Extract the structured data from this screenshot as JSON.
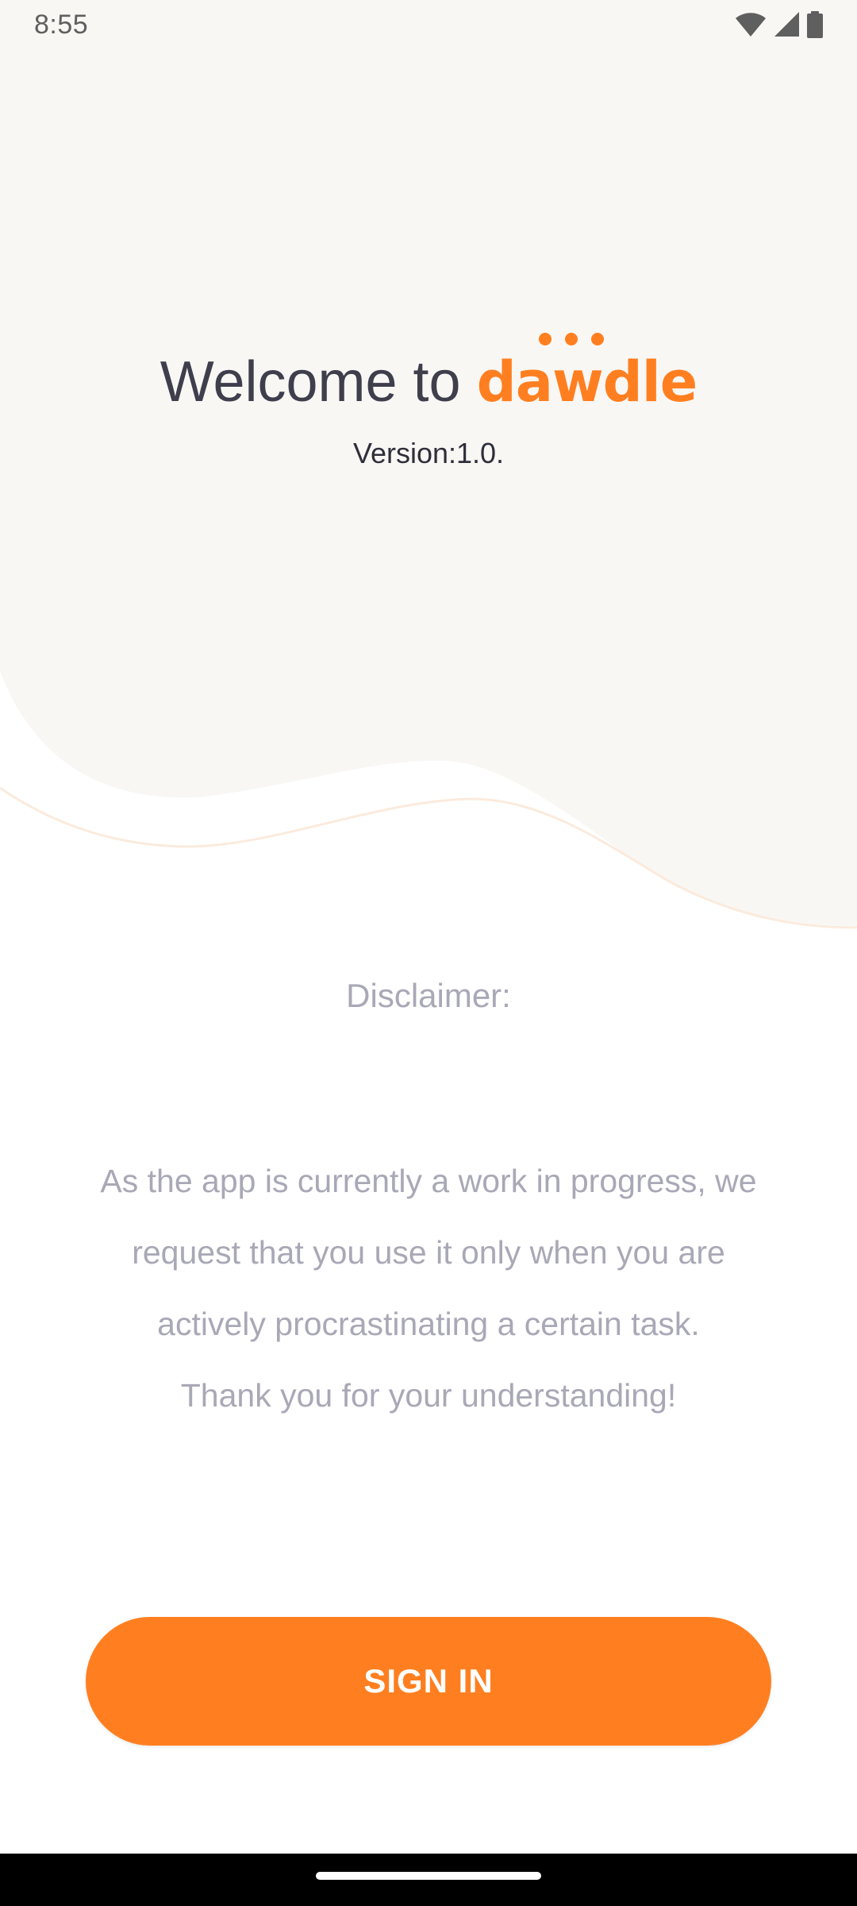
{
  "status_bar": {
    "time": "8:55",
    "icons": [
      "wifi-icon",
      "signal-icon",
      "battery-icon"
    ]
  },
  "header": {
    "welcome_prefix": "Welcome to",
    "brand_name": "dawdle",
    "version": "Version:1.0."
  },
  "disclaimer": {
    "title": "Disclaimer:",
    "lines": [
      "As the app is currently a work in progress, we",
      "request that you use it only when you are",
      "actively procrastinating a certain task.",
      "Thank you for your understanding!"
    ]
  },
  "actions": {
    "sign_in_label": "SIGN IN"
  },
  "colors": {
    "accent": "#FF7F20",
    "background_top": "#F9F7F4",
    "text_dark": "#3E3E4C",
    "text_muted": "#A9A8B6"
  }
}
